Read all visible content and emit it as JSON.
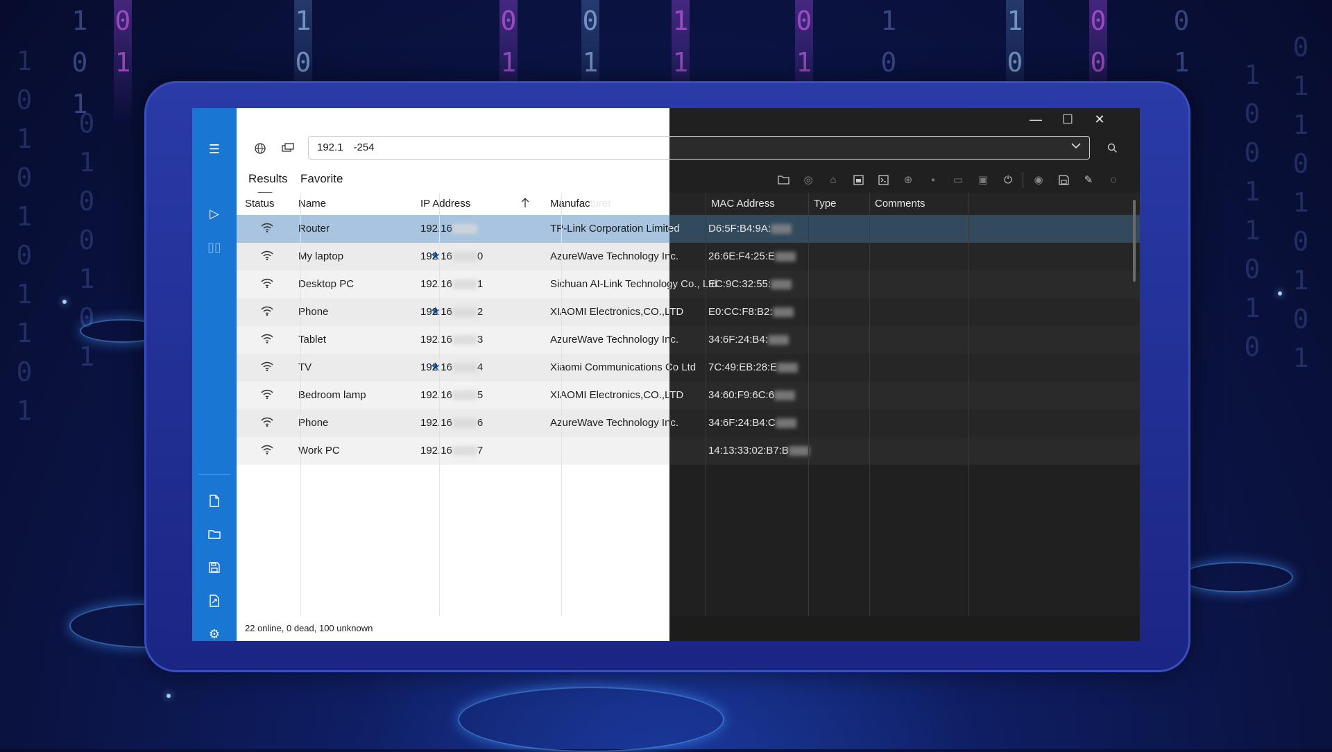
{
  "address": {
    "value": "192.1     -254"
  },
  "tabs": [
    {
      "label": "Results",
      "active": true
    },
    {
      "label": "Favorite",
      "active": false
    }
  ],
  "columns": {
    "status": "Status",
    "name": "Name",
    "ip": "IP Address",
    "manufacturer": "Manufacturer",
    "mac": "MAC Address",
    "type": "Type",
    "comments": "Comments"
  },
  "rows": [
    {
      "name": "Router",
      "ip": "192.16",
      "manufacturer": "TP-Link Corporation Limited",
      "mac": "D6:5F:B4:9A:",
      "favorite": false,
      "selected": true
    },
    {
      "name": "My laptop",
      "ip": "192.16",
      "ip_tail": "0",
      "manufacturer": "AzureWave Technology Inc.",
      "mac": "26:6E:F4:25:E",
      "favorite": true
    },
    {
      "name": "Desktop PC",
      "ip": "192.16",
      "ip_tail": "1",
      "manufacturer": "Sichuan AI-Link Technology Co., Ltd.",
      "mac": "EC:9C:32:55:",
      "favorite": false
    },
    {
      "name": "Phone",
      "ip": "192.16",
      "ip_tail": "2",
      "manufacturer": "XIAOMI Electronics,CO.,LTD",
      "mac": "E0:CC:F8:B2:",
      "favorite": true
    },
    {
      "name": "Tablet",
      "ip": "192.16",
      "ip_tail": "3",
      "manufacturer": "AzureWave Technology Inc.",
      "mac": "34:6F:24:B4:",
      "favorite": false
    },
    {
      "name": "TV",
      "ip": "192.16",
      "ip_tail": "4",
      "manufacturer": "Xiaomi Communications Co Ltd",
      "mac": "7C:49:EB:28:E",
      "favorite": true
    },
    {
      "name": "Bedroom lamp",
      "ip": "192.16",
      "ip_tail": "5",
      "manufacturer": "XIAOMI Electronics,CO.,LTD",
      "mac": "34:60:F9:6C:6",
      "favorite": false
    },
    {
      "name": "Phone",
      "ip": "192.16",
      "ip_tail": "6",
      "manufacturer": "AzureWave Technology Inc.",
      "mac": "34:6F:24:B4:C",
      "favorite": false
    },
    {
      "name": "Work PC",
      "ip": "192.16",
      "ip_tail": "7",
      "manufacturer": "",
      "mac": "14:13:33:02:B7:B",
      "favorite": false
    }
  ],
  "status_bar": "22 online, 0 dead, 100 unknown",
  "icons": {
    "menu": "menu-icon",
    "scan": "play-icon",
    "pause": "pause-icon",
    "accent_color": "#1976d2",
    "favorite_color": "#1565c0"
  }
}
